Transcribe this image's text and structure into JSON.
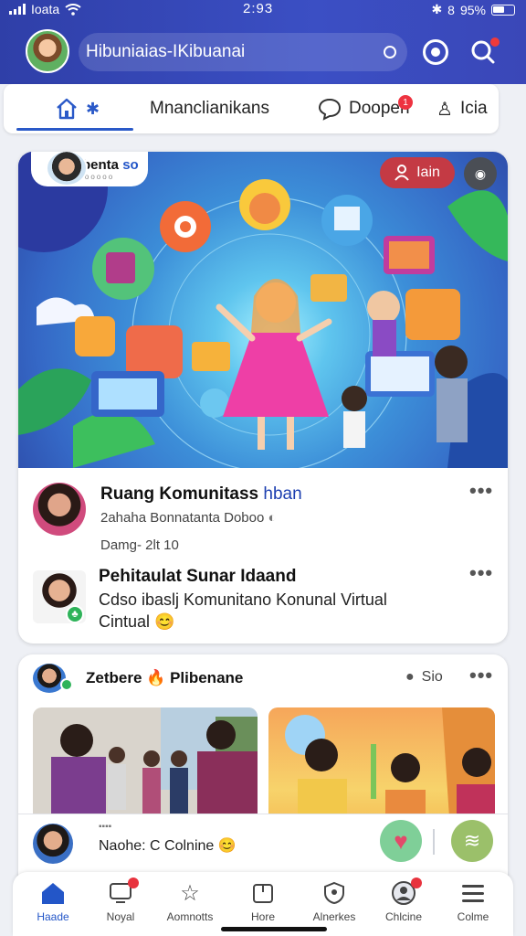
{
  "status_bar": {
    "carrier": "Ioata",
    "time": "2:93",
    "battery": "95%"
  },
  "header": {
    "search_text": "Hibuniaias-IKibuanai"
  },
  "tabs": [
    {
      "label": "",
      "icon": "home-icon"
    },
    {
      "label": "Mnanclianikans"
    },
    {
      "label": "Doopen",
      "icon": "chat-bubble-icon"
    },
    {
      "label": "Icia",
      "icon": "person-icon"
    }
  ],
  "feed_card_1": {
    "badge_name": "Sbenta",
    "badge_tag": "so",
    "badge_sub": "ooooooo",
    "login_label": "Iain",
    "post_1": {
      "title_a": "Ruang Komunitass",
      "title_b": "hban",
      "subtitle": "2ahaha Bonnatanta Doboo",
      "meta": "Damg- 2lt  10"
    },
    "post_2": {
      "title": "Pehitaulat Sunar Idaand",
      "text": "Cdso ibaslj Komunitano Konunal Virtual",
      "text2": "Cintual"
    }
  },
  "feed_card_2": {
    "author": "Zetbere",
    "page_name": "Plibenane",
    "location": "Sio",
    "comment_label": "Naohe: C Colnine"
  },
  "bottom_nav": [
    {
      "label": "Haade",
      "icon": "home-icon",
      "active": true
    },
    {
      "label": "Noyal",
      "icon": "inbox-icon",
      "badge": true
    },
    {
      "label": "Aomnotts",
      "icon": "star-icon"
    },
    {
      "label": "Hore",
      "icon": "box-icon"
    },
    {
      "label": "Alnerkes",
      "icon": "shield-chat-icon"
    },
    {
      "label": "Chlcine",
      "icon": "profile-icon",
      "badge": true
    },
    {
      "label": "Colme",
      "icon": "menu-icon"
    }
  ],
  "colors": {
    "header_blue": "#3346b4",
    "accent_blue": "#2356c8",
    "badge_red": "#e8333e"
  }
}
